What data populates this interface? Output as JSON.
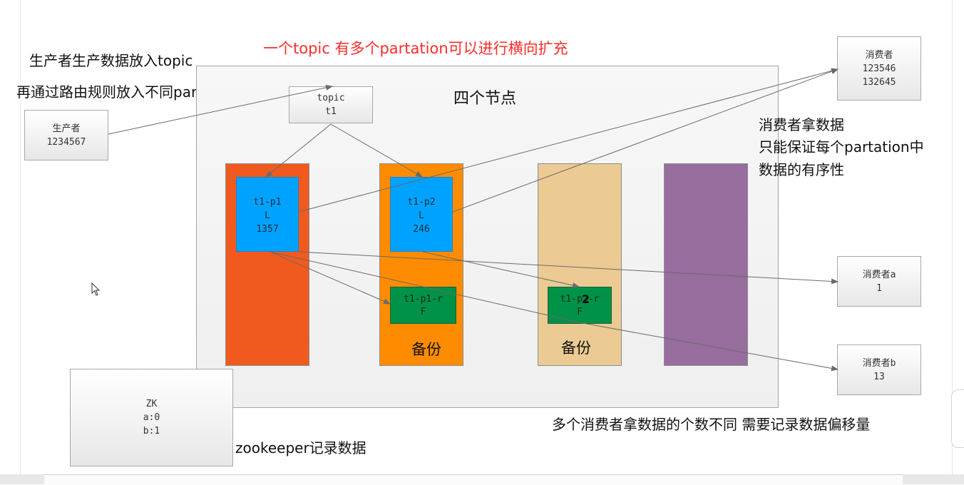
{
  "headline": "一个topic 有多个partation可以进行横向扩充",
  "producer_note": {
    "line1": "生产者生产数据放入topic",
    "line2": "再通过路由规则放入不同partation"
  },
  "cluster_label": "四个节点",
  "producer": {
    "title": "生产者",
    "data": "1234567"
  },
  "topic": {
    "title": "topic",
    "name": "t1"
  },
  "partitions": [
    {
      "name": "t1-p1",
      "role": "L",
      "data": "1357"
    },
    {
      "name": "t1-p2",
      "role": "L",
      "data": "246"
    }
  ],
  "replicas": [
    {
      "name": "t1-p1-r",
      "role": "F"
    },
    {
      "name": "t1-p2-r",
      "role": "F"
    }
  ],
  "replica_overlay_char": "2",
  "backup_labels": [
    "备份",
    "备份"
  ],
  "consumers": [
    {
      "title": "消费者",
      "lines": [
        "123546",
        "132645"
      ]
    },
    {
      "title": "消费者a",
      "lines": [
        "1"
      ]
    },
    {
      "title": "消费者b",
      "lines": [
        "13"
      ]
    }
  ],
  "consumer_note": {
    "line1": "消费者拿数据",
    "line2": "只能保证每个partation中",
    "line3": "数据的有序性"
  },
  "offset_note": "多个消费者拿数据的个数不同 需要记录数据偏移量",
  "zk": {
    "title": "ZK",
    "lines": [
      "a:0",
      "b:1"
    ]
  },
  "zk_note": "zookeeper记录数据",
  "colors": {
    "headline": "#ff2b2b",
    "node1": "#f05a1e",
    "node2": "#ff8c00",
    "node3": "#ebcb93",
    "node4": "#976e9e",
    "partition": "#00a2ff",
    "replica": "#009247"
  }
}
